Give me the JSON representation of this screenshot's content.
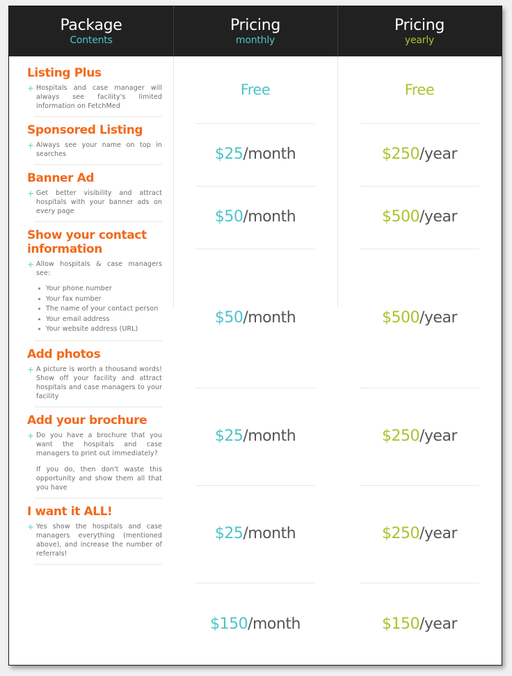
{
  "header": {
    "package": {
      "title": "Package",
      "subtitle": "Contents"
    },
    "monthly": {
      "title": "Pricing",
      "subtitle": "monthly"
    },
    "yearly": {
      "title": "Pricing",
      "subtitle": "yearly"
    }
  },
  "colors": {
    "header_bg": "#212121",
    "heading_orange": "#f2691b",
    "monthly_teal": "#4ec3cb",
    "yearly_lime": "#a8c42c",
    "body_gray": "#6d6d6d",
    "unit_gray": "#555555"
  },
  "features": [
    {
      "title": "Listing Plus",
      "marker": "+",
      "body": "Hospitals and case manager will always see facility's limited information on FetchMed"
    },
    {
      "title": "Sponsored Listing",
      "marker": "+",
      "body": "Always see your name on top in searches"
    },
    {
      "title": "Banner Ad",
      "marker": "+",
      "body": "Get better visibility and attract hospitals with your banner ads on every page"
    },
    {
      "title": "Show your contact information",
      "marker": "+",
      "body": "Allow hospitals & case managers see:",
      "sublist": [
        "Your phone number",
        "Your fax number",
        "The name of your contact person",
        "Your email address",
        "Your website address (URL)"
      ]
    },
    {
      "title": "Add photos",
      "marker": "+",
      "body": "A picture is worth a thousand words! Show off your facility and attract hospitals and case managers to your facility"
    },
    {
      "title": "Add your brochure",
      "marker": "+",
      "body": "Do you have a brochure that you want the hospitals and case managers to print out immediately?",
      "body2": "If you do, then don't waste this opportunity and show them all that you have"
    },
    {
      "title": "I want it ALL!",
      "marker": "+",
      "body": "Yes show the hospitals and case managers everything (mentioned above), and increase the number of referrals!"
    }
  ],
  "pricing": {
    "monthly": [
      {
        "amount": "Free",
        "unit": "",
        "free": true
      },
      {
        "amount": "$25",
        "unit": "/month",
        "free": false
      },
      {
        "amount": "$50",
        "unit": "/month",
        "free": false
      },
      {
        "amount": "$50",
        "unit": "/month",
        "free": false
      },
      {
        "amount": "$25",
        "unit": "/month",
        "free": false
      },
      {
        "amount": "$25",
        "unit": "/month",
        "free": false
      },
      {
        "amount": "$150",
        "unit": "/month",
        "free": false
      }
    ],
    "yearly": [
      {
        "amount": "Free",
        "unit": "",
        "free": true
      },
      {
        "amount": "$250",
        "unit": "/year",
        "free": false
      },
      {
        "amount": "$500",
        "unit": "/year",
        "free": false
      },
      {
        "amount": "$500",
        "unit": "/year",
        "free": false
      },
      {
        "amount": "$250",
        "unit": "/year",
        "free": false
      },
      {
        "amount": "$250",
        "unit": "/year",
        "free": false
      },
      {
        "amount": "$150",
        "unit": "/year",
        "free": false
      }
    ]
  }
}
